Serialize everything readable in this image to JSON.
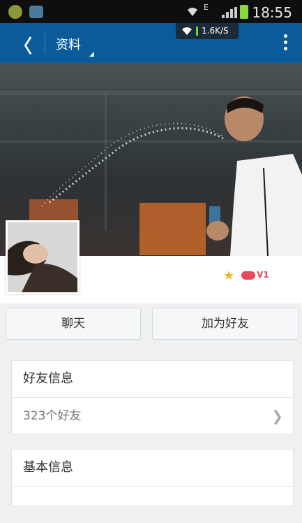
{
  "status_bar": {
    "time": "18:55",
    "network_type": "E"
  },
  "net_speed": "1.6K/S",
  "app_bar": {
    "back_label": "〈",
    "title": "资料"
  },
  "profile": {
    "vip_badge": "V1"
  },
  "actions": {
    "chat_label": "聊天",
    "add_friend_label": "加为好友"
  },
  "friends_card": {
    "title": "好友信息",
    "count_label": "323个好友"
  },
  "basic_card": {
    "title": "基本信息"
  },
  "colors": {
    "appbar": "#0b5a9a",
    "accent_star": "#f2b51c",
    "vip": "#e8485a"
  }
}
